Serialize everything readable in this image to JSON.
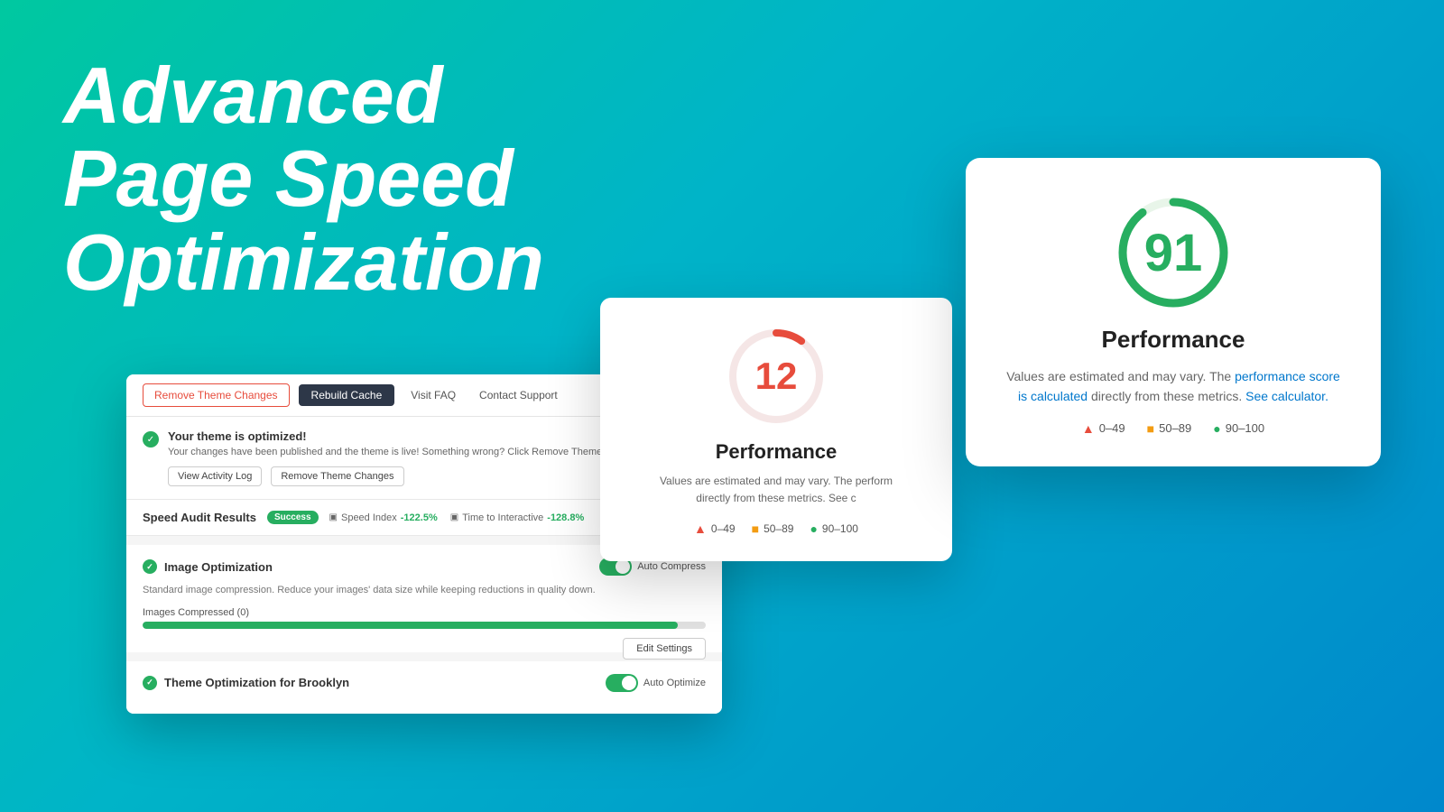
{
  "hero": {
    "line1": "Advanced",
    "line2": "Page Speed",
    "line3": "Optimization"
  },
  "plugin": {
    "toolbar": {
      "btn_remove": "Remove Theme Changes",
      "btn_rebuild": "Rebuild Cache",
      "btn_faq": "Visit FAQ",
      "btn_support": "Contact Support"
    },
    "success_banner": {
      "title": "Your theme is optimized!",
      "desc": "Your changes have been published and the theme is live! Something wrong? Click Remove Theme Changes to",
      "btn_activity": "View Activity Log",
      "btn_remove": "Remove Theme Changes"
    },
    "speed_audit": {
      "label": "Speed Audit Results",
      "badge": "Success",
      "speed_index_label": "Speed Index",
      "speed_index_val": "-122.5%",
      "tti_label": "Time to Interactive",
      "tti_val": "-128.8%"
    },
    "image_optimization": {
      "title": "Image Optimization",
      "toggle_label": "Auto Compress",
      "desc": "Standard image compression. Reduce your images' data size while keeping reductions in quality down.",
      "progress_label": "Images Compressed (0)",
      "progress_pct": 95,
      "btn_edit": "Edit Settings"
    },
    "theme_optimization": {
      "title": "Theme Optimization for Brooklyn",
      "toggle_label": "Auto Optimize"
    }
  },
  "perf_12": {
    "score": "12",
    "title": "Performance",
    "desc": "Values are estimated and may vary. The perform",
    "desc2": "directly from these metrics. See c",
    "legend": [
      {
        "range": "0–49",
        "color": "red"
      },
      {
        "range": "50–89",
        "color": "yellow"
      },
      {
        "range": "90–100",
        "color": "green"
      }
    ]
  },
  "perf_91": {
    "score": "91",
    "title": "Performance",
    "desc": "Values are estimated and may vary. The ",
    "link1": "performance score is calculated",
    "link2": "See calculator.",
    "desc_mid": " directly from these metrics. ",
    "full_desc": "Values are estimated and may vary. The performance score is calculated directly from these metrics. See calculator.",
    "legend": [
      {
        "range": "0–49",
        "color": "red"
      },
      {
        "range": "50–89",
        "color": "yellow"
      },
      {
        "range": "90–100",
        "color": "green"
      }
    ]
  }
}
